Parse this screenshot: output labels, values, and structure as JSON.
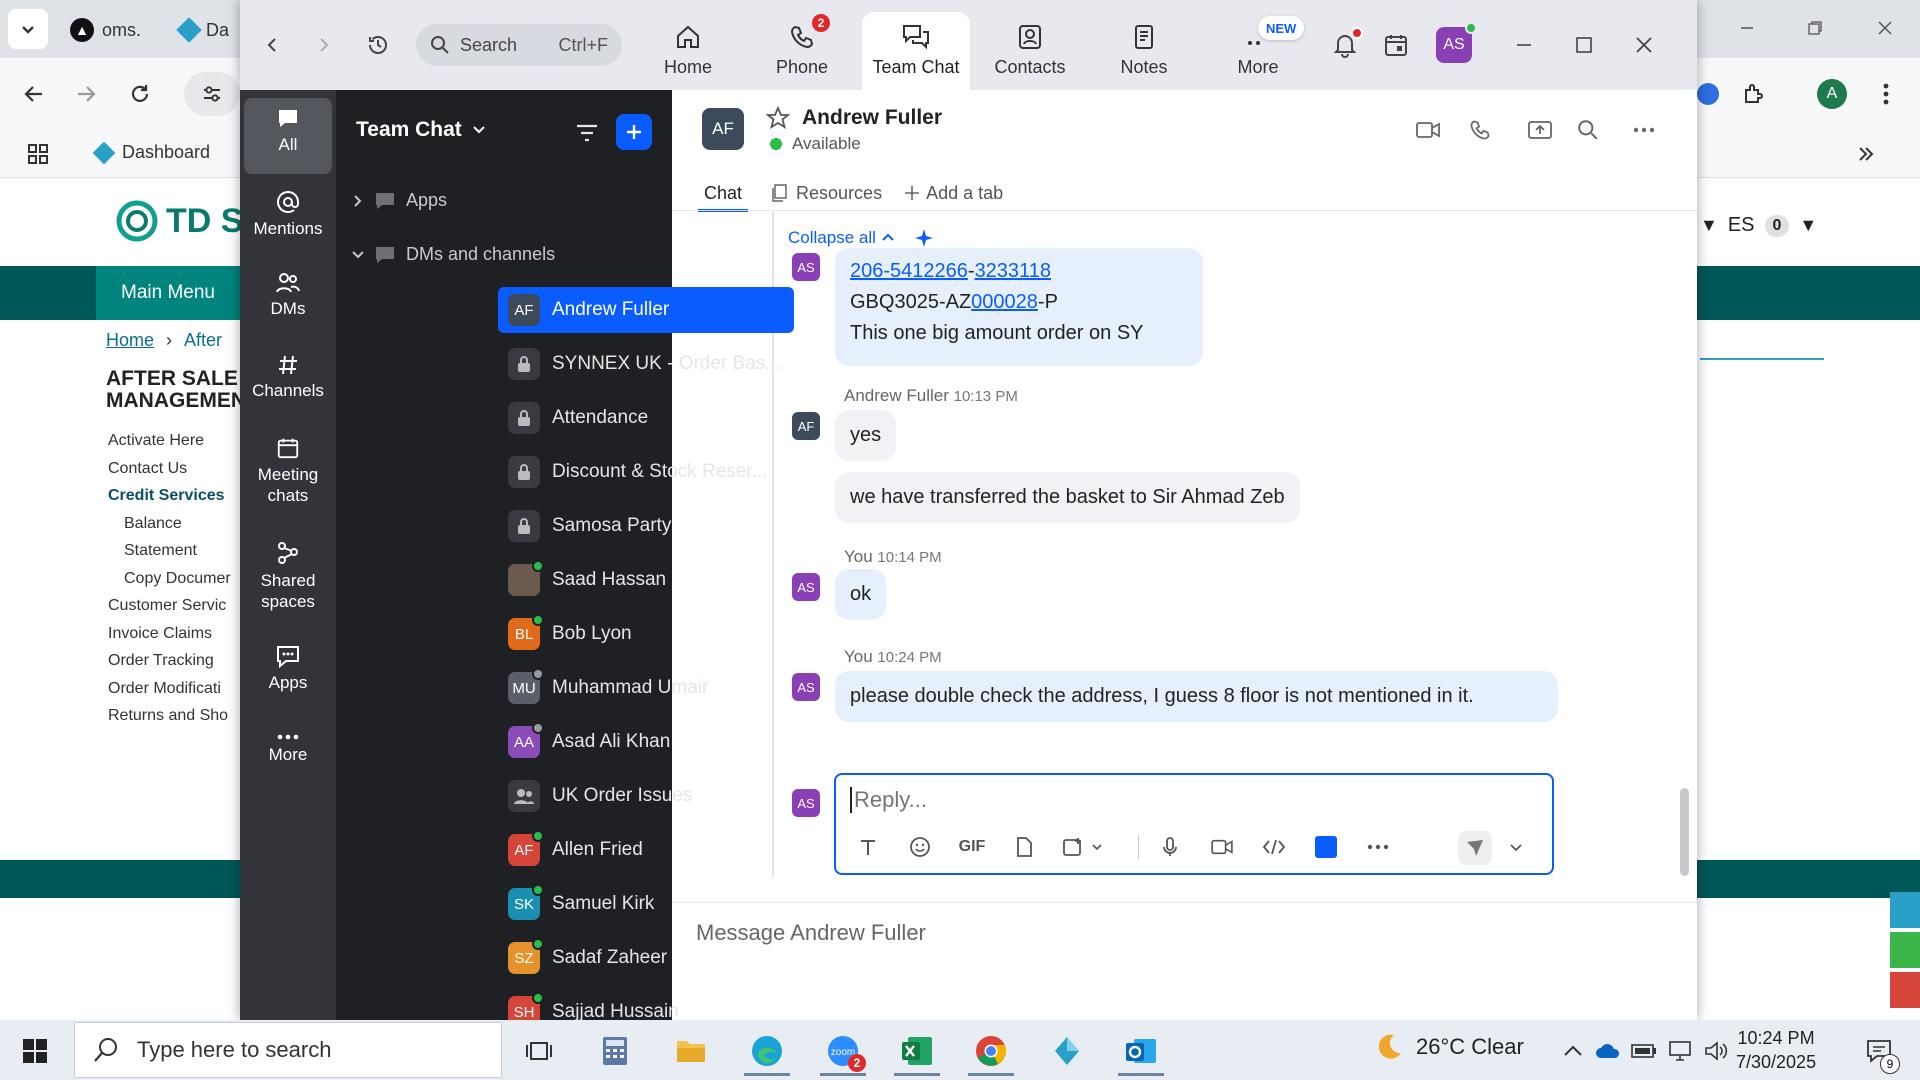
{
  "browser": {
    "tabs": [
      {
        "label": "oms."
      },
      {
        "label": "Da"
      }
    ],
    "bookmarks": {
      "dashboard_label": "Dashboard"
    },
    "profile_initial": "A"
  },
  "site": {
    "logo_text": "TD SY",
    "main_menu_label": "Main Menu",
    "breadcrumb": {
      "home": "Home",
      "current": "After"
    },
    "heading": "AFTER SALE MANAGEMEN",
    "menu": [
      {
        "label": "Activate Here",
        "indent": false
      },
      {
        "label": "Contact Us",
        "indent": false
      },
      {
        "label": "Credit Services",
        "indent": false,
        "expanded": true
      },
      {
        "label": "Balance",
        "indent": true
      },
      {
        "label": "Statement",
        "indent": true
      },
      {
        "label": "Copy Documer",
        "indent": true
      },
      {
        "label": "Customer Servic",
        "indent": false
      },
      {
        "label": "Invoice Claims",
        "indent": false
      },
      {
        "label": "Order Tracking",
        "indent": false
      },
      {
        "label": "Order Modificati",
        "indent": false
      },
      {
        "label": "Returns and Sho",
        "indent": false
      }
    ],
    "lang": "ES",
    "cart_count": "0"
  },
  "zoom": {
    "search": {
      "label": "Search",
      "shortcut": "Ctrl+F"
    },
    "nav": [
      {
        "id": "home",
        "label": "Home",
        "icon": "home-icon"
      },
      {
        "id": "phone",
        "label": "Phone",
        "icon": "phone-icon",
        "badge": "2"
      },
      {
        "id": "team-chat",
        "label": "Team Chat",
        "icon": "chat-icon",
        "active": true
      },
      {
        "id": "contacts",
        "label": "Contacts",
        "icon": "contacts-icon"
      },
      {
        "id": "notes",
        "label": "Notes",
        "icon": "notes-icon"
      },
      {
        "id": "more",
        "label": "More",
        "icon": "more-icon",
        "new_badge": "NEW"
      }
    ],
    "user_initials": "AS",
    "rail": [
      {
        "label": "All",
        "icon": "chat-bubble-icon",
        "active": true
      },
      {
        "label": "Mentions",
        "icon": "at-icon"
      },
      {
        "label": "DMs",
        "icon": "people-icon"
      },
      {
        "label": "Channels",
        "icon": "hash-icon"
      },
      {
        "label": "Meeting chats",
        "icon": "calendar-icon"
      },
      {
        "label": "Shared spaces",
        "icon": "shared-spaces-icon"
      },
      {
        "label": "Apps",
        "icon": "apps-icon"
      },
      {
        "label": "More",
        "icon": "more-dots-icon"
      }
    ],
    "list": {
      "title": "Team Chat",
      "apps_label": "Apps",
      "dms_label": "DMs and channels",
      "chats": [
        {
          "name": "Andrew Fuller",
          "initials": "AF",
          "color": "#3c4a5c",
          "active": true
        },
        {
          "name": "SYNNEX UK - Order Bas...",
          "type": "locked"
        },
        {
          "name": "Attendance",
          "type": "locked"
        },
        {
          "name": "Discount & Stock Reser...",
          "type": "locked"
        },
        {
          "name": "Samosa Party",
          "type": "locked"
        },
        {
          "name": "Saad Hassan",
          "initials": "",
          "color": "#6b5b4e",
          "status": "#2bbd4a"
        },
        {
          "name": "Bob Lyon",
          "initials": "BL",
          "color": "#e06a1b",
          "status": "#2bbd4a"
        },
        {
          "name": "Muhammad Umair",
          "initials": "MU",
          "color": "#5a5f6b",
          "status": "#9a9ba0"
        },
        {
          "name": "Asad Ali Khan",
          "initials": "AA",
          "color": "#8b4bb8",
          "status": "#9a9ba0"
        },
        {
          "name": "UK Order Issues",
          "type": "group"
        },
        {
          "name": "Allen Fried",
          "initials": "AF",
          "color": "#d6453a",
          "status": "#2bbd4a"
        },
        {
          "name": "Samuel Kirk",
          "initials": "SK",
          "color": "#1a8fb0",
          "status": "#2bbd4a"
        },
        {
          "name": "Sadaf Zaheer",
          "initials": "SZ",
          "color": "#e6922a",
          "status": "#2bbd4a"
        },
        {
          "name": "Sajjad Hussain",
          "initials": "SH",
          "color": "#d6453a",
          "status": "#2bbd4a"
        }
      ]
    },
    "conversation": {
      "contact_initials": "AF",
      "contact_name": "Andrew Fuller",
      "status": "Available",
      "tabs": {
        "chat": "Chat",
        "resources": "Resources",
        "add_tab": "Add a tab"
      },
      "collapse_all": "Collapse all",
      "messages": [
        {
          "sender": "AS",
          "lines": [
            "206-5412266-3233118",
            "GBQ3025-AZ000028-P",
            "This one big amount order on SY"
          ]
        },
        {
          "sender": "Andrew Fuller",
          "time": "10:13 PM",
          "text": "yes"
        },
        {
          "sender": "Andrew Fuller",
          "text": "we have transferred the basket to Sir Ahmad Zeb"
        },
        {
          "sender": "You",
          "time": "10:14 PM",
          "text": "ok"
        },
        {
          "sender": "You",
          "time": "10:24 PM",
          "text": "please double check the address, I guess 8 floor is not mentioned in it."
        }
      ],
      "phone_link_1": "206-5412266",
      "phone_dash": "-",
      "phone_link_2": "3233118",
      "order_prefix": "GBQ3025-AZ",
      "order_link": "000028",
      "order_suffix": "-P",
      "msg1_line3": "This one big amount order on SY",
      "reply_placeholder": "Reply...",
      "gif_label": "GIF",
      "bottom_placeholder": "Message Andrew Fuller"
    }
  },
  "taskbar": {
    "search_placeholder": "Type here to search",
    "zoom_badge": "2",
    "weather": "26°C  Clear",
    "time": "10:24 PM",
    "date": "7/30/2025",
    "notifications": "9"
  }
}
